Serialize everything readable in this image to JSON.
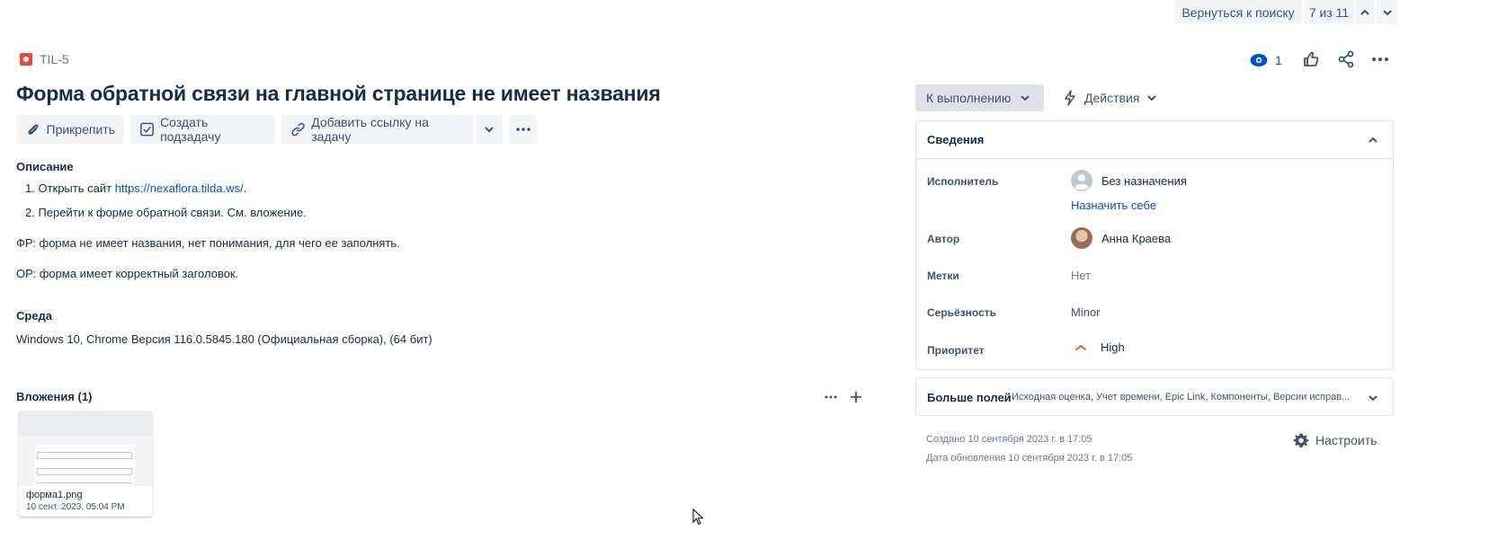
{
  "topnav": {
    "back_label": "Вернуться к поиску",
    "counter": "7 из 11"
  },
  "issue": {
    "key": "TIL-5",
    "title": "Форма обратной связи на главной странице не имеет названия",
    "watch_count": "1"
  },
  "toolbar": {
    "attach_label": "Прикрепить",
    "subtask_label": "Создать подзадачу",
    "link_label": "Добавить ссылку на задачу"
  },
  "description": {
    "heading": "Описание",
    "step1_prefix": "1. Открыть сайт ",
    "step1_link": "https://nexaflora.tilda.ws/",
    "step1_suffix": ".",
    "step2": "2. Перейти к форме обратной связи. См. вложение.",
    "fr": "ФР: форма не имеет названия, нет понимания, для чего ее заполнять.",
    "or": "ОР: форма имеет корректный заголовок."
  },
  "environment": {
    "heading": "Среда",
    "value": "Windows 10, Chrome Версия 116.0.5845.180 (Официальная сборка), (64 бит)"
  },
  "attachments": {
    "heading": "Вложения (1)",
    "file_name": "форма1.png",
    "file_date": "10 сент. 2023, 05:04 PM"
  },
  "status": {
    "label": "К выполнению",
    "actions_label": "Действия"
  },
  "details": {
    "heading": "Сведения",
    "assignee_label": "Исполнитель",
    "assignee_value": "Без назначения",
    "assign_self": "Назначить себе",
    "reporter_label": "Автор",
    "reporter_value": "Анна Краева",
    "labels_label": "Метки",
    "labels_value": "Нет",
    "severity_label": "Серьёзность",
    "severity_value": "Minor",
    "priority_label": "Приоритет",
    "priority_value": "High"
  },
  "more_fields": {
    "heading": "Больше полей",
    "summary": "Исходная оценка, Учет времени, Epic Link, Компоненты, Версии исправ..."
  },
  "meta": {
    "created": "Создано 10 сентября 2023 г. в 17:05",
    "updated": "Дата обновления 10 сентября 2023 г. в 17:05",
    "configure_label": "Настроить"
  },
  "colors": {
    "accent": "#0052cc",
    "priority_high": "#ff5630",
    "issue_type_bug": "#e5493a"
  }
}
